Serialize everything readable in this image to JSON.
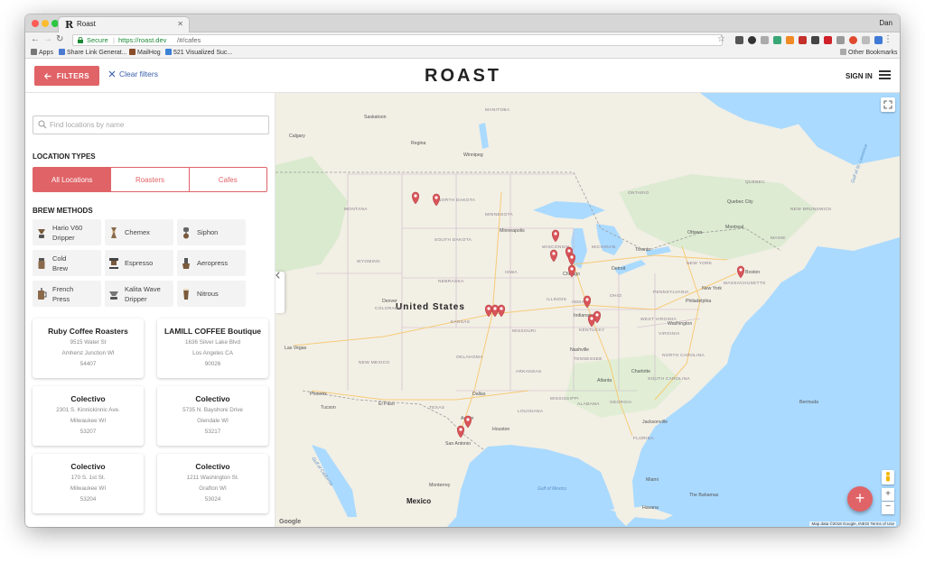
{
  "browser": {
    "tab_title": "Roast",
    "tab_favicon": "R",
    "profile": "Dan",
    "secure_label": "Secure",
    "url_host": "https://roast.dev",
    "url_path": "/#/cafes",
    "bookmarks": [
      "Apps",
      "Share Link Generat...",
      "MailHog",
      "521 Visualized Suc..."
    ],
    "other_bookmarks": "Other Bookmarks"
  },
  "header": {
    "filters_label": "FILTERS",
    "clear_filters_label": "Clear filters",
    "logo": "ROAST",
    "sign_in_label": "SIGN IN"
  },
  "sidebar": {
    "search_placeholder": "Find locations by name",
    "location_types_title": "LOCATION TYPES",
    "location_types": [
      "All Locations",
      "Roasters",
      "Cafes"
    ],
    "active_location_type": "All Locations",
    "brew_methods_title": "BREW METHODS",
    "brew_methods": [
      {
        "line1": "Hario V60",
        "line2": "Dripper",
        "icon": "hario-v60-icon"
      },
      {
        "line1": "Chemex",
        "line2": "",
        "icon": "chemex-icon"
      },
      {
        "line1": "Siphon",
        "line2": "",
        "icon": "siphon-icon"
      },
      {
        "line1": "Cold",
        "line2": "Brew",
        "icon": "cold-brew-icon"
      },
      {
        "line1": "Espresso",
        "line2": "",
        "icon": "espresso-icon"
      },
      {
        "line1": "Aeropress",
        "line2": "",
        "icon": "aeropress-icon"
      },
      {
        "line1": "French",
        "line2": "Press",
        "icon": "french-press-icon"
      },
      {
        "line1": "Kalita Wave",
        "line2": "Dripper",
        "icon": "kalita-wave-icon"
      },
      {
        "line1": "Nitrous",
        "line2": "",
        "icon": "nitrous-icon"
      }
    ],
    "cafes": [
      {
        "name": "Ruby Coffee Roasters",
        "street": "9515 Water St",
        "city": "Amherst Junction WI",
        "zip": "54407"
      },
      {
        "name": "LAMILL COFFEE Boutique",
        "street": "1636 Silver Lake Blvd",
        "city": "Los Angeles CA",
        "zip": "90026"
      },
      {
        "name": "Colectivo",
        "street": "2301 S. Kinnickinnic Ave.",
        "city": "Milwaukee WI",
        "zip": "53207"
      },
      {
        "name": "Colectivo",
        "street": "5735 N. Bayshore Drive",
        "city": "Glendale WI",
        "zip": "53217"
      },
      {
        "name": "Colectivo",
        "street": "170 S. 1st St.",
        "city": "Milwaukee WI",
        "zip": "53204"
      },
      {
        "name": "Colectivo",
        "street": "1211 Washington St.",
        "city": "Grafton WI",
        "zip": "53024"
      }
    ]
  },
  "map": {
    "country_label": "United States",
    "mexico_label": "Mexico",
    "cities": [
      "Calgary",
      "Saskatoon",
      "Regina",
      "Winnipeg",
      "Minneapolis",
      "Chicago",
      "Detroit",
      "Toronto",
      "Ottawa",
      "Montreal",
      "Quebec City",
      "Boston",
      "New York",
      "Philadelphia",
      "Washington",
      "Indianapolis",
      "Nashville",
      "Atlanta",
      "Charlotte",
      "Jacksonville",
      "Dallas",
      "Austin",
      "Houston",
      "San Antonio",
      "El Paso",
      "Phoenix",
      "Tucson",
      "Las Vegas",
      "Denver",
      "Monterrey",
      "Havana",
      "Miami",
      "Bermuda",
      "The Bahamas"
    ],
    "states": [
      "NORTH DAKOTA",
      "SOUTH DAKOTA",
      "MINNESOTA",
      "WISCONSIN",
      "MICHIGAN",
      "IOWA",
      "ILLINOIS",
      "INDIANA",
      "OHIO",
      "NEBRASKA",
      "KANSAS",
      "MISSOURI",
      "KENTUCKY",
      "TENNESSEE",
      "OKLAHOMA",
      "ARKANSAS",
      "MISSISSIPPI",
      "ALABAMA",
      "GEORGIA",
      "TEXAS",
      "NEW MEXICO",
      "COLORADO",
      "WYOMING",
      "MONTANA",
      "PENNSYLVANIA",
      "NEW YORK",
      "VIRGINIA",
      "NORTH CAROLINA",
      "SOUTH CAROLINA",
      "FLORIDA",
      "LOUISIANA",
      "MAINE",
      "MASSACHUSETTS",
      "WEST VIRGINIA",
      "ONTARIO",
      "QUEBEC",
      "MANITOBA",
      "NEW BRUNSWICK"
    ],
    "water": [
      "Gulf of Mexico",
      "Gulf of California",
      "Gulf of St. Lawrence"
    ],
    "attribution": "Map data ©2018 Google, INEGI  Terms of Use",
    "google": "Google",
    "zoom_in": "+",
    "zoom_out": "−",
    "add_label": "+"
  },
  "colors": {
    "accent": "#e06367",
    "water": "#aadaff",
    "land": "#f2efe5",
    "park": "#cfe8c5"
  }
}
